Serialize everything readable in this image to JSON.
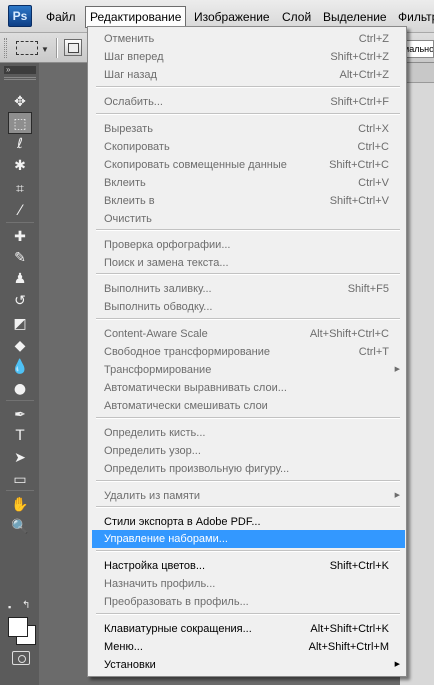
{
  "menubar": {
    "logo": "Ps",
    "items": [
      "Файл",
      "Редактирование",
      "Изображение",
      "Слой",
      "Выделение",
      "Фильтр"
    ]
  },
  "optionsbar": {
    "mode_fragment": "мальное"
  },
  "tools": {
    "header_icon": "»",
    "items": [
      {
        "name": "move-tool-icon",
        "glyph": "✥"
      },
      {
        "name": "rectangular-marquee-tool-icon",
        "glyph": "⬚"
      },
      {
        "name": "lasso-tool-icon",
        "glyph": "ℓ"
      },
      {
        "name": "magic-wand-tool-icon",
        "glyph": "✱"
      },
      {
        "name": "crop-tool-icon",
        "glyph": "⌗"
      },
      {
        "name": "eyedropper-tool-icon",
        "glyph": "⁄"
      },
      {
        "name": "healing-brush-tool-icon",
        "glyph": "✚"
      },
      {
        "name": "brush-tool-icon",
        "glyph": "✎"
      },
      {
        "name": "clone-stamp-tool-icon",
        "glyph": "♟"
      },
      {
        "name": "history-brush-tool-icon",
        "glyph": "↺"
      },
      {
        "name": "eraser-tool-icon",
        "glyph": "◩"
      },
      {
        "name": "paint-bucket-tool-icon",
        "glyph": "◆"
      },
      {
        "name": "blur-tool-icon",
        "glyph": "💧"
      },
      {
        "name": "dodge-tool-icon",
        "glyph": "●"
      },
      {
        "name": "pen-tool-icon",
        "glyph": "✒"
      },
      {
        "name": "type-tool-icon",
        "glyph": "T"
      },
      {
        "name": "path-selection-tool-icon",
        "glyph": "➤"
      },
      {
        "name": "shape-tool-icon",
        "glyph": "▭"
      },
      {
        "name": "hand-tool-icon",
        "glyph": "✋"
      },
      {
        "name": "zoom-tool-icon",
        "glyph": "🔍"
      }
    ],
    "default_colors_icon": "▪",
    "swap_colors_icon": "↰"
  },
  "edit_menu": {
    "items": [
      {
        "label": "Отменить",
        "shortcut": "Ctrl+Z",
        "state": "disabled"
      },
      {
        "label": "Шаг вперед",
        "shortcut": "Shift+Ctrl+Z",
        "state": "disabled"
      },
      {
        "label": "Шаг назад",
        "shortcut": "Alt+Ctrl+Z",
        "state": "disabled"
      },
      {
        "label": "Ослабить...",
        "shortcut": "Shift+Ctrl+F",
        "state": "disabled"
      },
      {
        "label": "Вырезать",
        "shortcut": "Ctrl+X",
        "state": "disabled"
      },
      {
        "label": "Скопировать",
        "shortcut": "Ctrl+C",
        "state": "disabled"
      },
      {
        "label": "Скопировать совмещенные данные",
        "shortcut": "Shift+Ctrl+C",
        "state": "disabled"
      },
      {
        "label": "Вклеить",
        "shortcut": "Ctrl+V",
        "state": "disabled"
      },
      {
        "label": "Вклеить в",
        "shortcut": "Shift+Ctrl+V",
        "state": "disabled"
      },
      {
        "label": "Очистить",
        "shortcut": "",
        "state": "disabled"
      },
      {
        "label": "Проверка орфографии...",
        "shortcut": "",
        "state": "disabled"
      },
      {
        "label": "Поиск и замена текста...",
        "shortcut": "",
        "state": "disabled"
      },
      {
        "label": "Выполнить заливку...",
        "shortcut": "Shift+F5",
        "state": "disabled"
      },
      {
        "label": "Выполнить обводку...",
        "shortcut": "",
        "state": "disabled"
      },
      {
        "label": "Content-Aware Scale",
        "shortcut": "Alt+Shift+Ctrl+C",
        "state": "disabled"
      },
      {
        "label": "Свободное трансформирование",
        "shortcut": "Ctrl+T",
        "state": "disabled"
      },
      {
        "label": "Трансформирование",
        "shortcut": "",
        "state": "disabled",
        "submenu": true
      },
      {
        "label": "Автоматически выравнивать слои...",
        "shortcut": "",
        "state": "disabled"
      },
      {
        "label": "Автоматически смешивать слои",
        "shortcut": "",
        "state": "disabled"
      },
      {
        "label": "Определить кисть...",
        "shortcut": "",
        "state": "disabled"
      },
      {
        "label": "Определить узор...",
        "shortcut": "",
        "state": "disabled"
      },
      {
        "label": "Определить произвольную фигуру...",
        "shortcut": "",
        "state": "disabled"
      },
      {
        "label": "Удалить из памяти",
        "shortcut": "",
        "state": "disabled",
        "submenu": true
      },
      {
        "label": "Стили экспорта в Adobe PDF...",
        "shortcut": "",
        "state": "enabled"
      },
      {
        "label": "Управление наборами...",
        "shortcut": "",
        "state": "highlight"
      },
      {
        "label": "Настройка цветов...",
        "shortcut": "Shift+Ctrl+K",
        "state": "enabled"
      },
      {
        "label": "Назначить профиль...",
        "shortcut": "",
        "state": "disabled"
      },
      {
        "label": "Преобразовать в профиль...",
        "shortcut": "",
        "state": "disabled"
      },
      {
        "label": "Клавиатурные сокращения...",
        "shortcut": "Alt+Shift+Ctrl+K",
        "state": "enabled"
      },
      {
        "label": "Меню...",
        "shortcut": "Alt+Shift+Ctrl+M",
        "state": "enabled"
      },
      {
        "label": "Установки",
        "shortcut": "",
        "state": "enabled",
        "submenu": true
      }
    ],
    "submenu_arrow": "▶"
  }
}
